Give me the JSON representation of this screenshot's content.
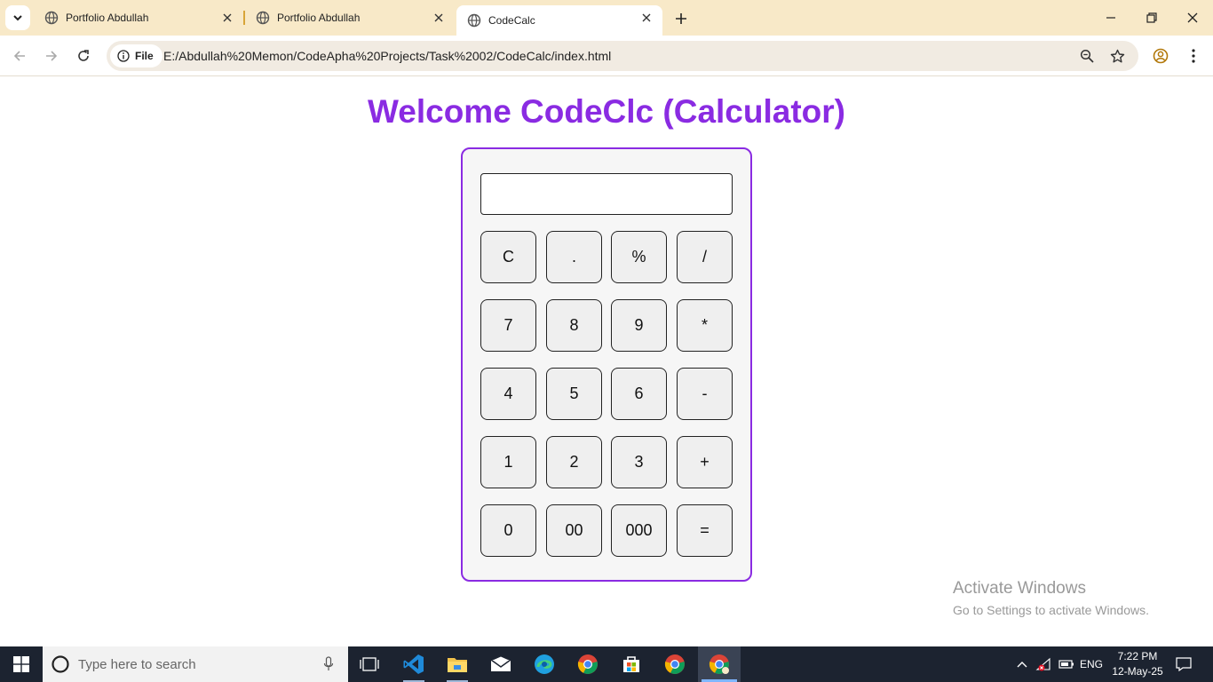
{
  "browser": {
    "tabs": [
      {
        "title": "Portfolio Abdullah",
        "active": false
      },
      {
        "title": "Portfolio Abdullah",
        "active": false
      },
      {
        "title": "CodeCalc",
        "active": true
      }
    ],
    "address": {
      "security_label": "File",
      "url": "E:/Abdullah%20Memon/CodeApha%20Projects/Task%2002/CodeCalc/index.html"
    }
  },
  "page": {
    "title": "Welcome CodeClc (Calculator)",
    "display_value": "",
    "keys": [
      [
        "C",
        ".",
        "%",
        "/"
      ],
      [
        "7",
        "8",
        "9",
        "*"
      ],
      [
        "4",
        "5",
        "6",
        "-"
      ],
      [
        "1",
        "2",
        "3",
        "+"
      ],
      [
        "0",
        "00",
        "000",
        "="
      ]
    ]
  },
  "watermark": {
    "line1": "Activate Windows",
    "line2": "Go to Settings to activate Windows."
  },
  "taskbar": {
    "search_placeholder": "Type here to search",
    "language": "ENG",
    "time": "7:22 PM",
    "date": "12-May-25"
  },
  "colors": {
    "accent": "#8a2be2",
    "tabstrip": "#f8e9c8",
    "taskbar": "#1c2330"
  }
}
